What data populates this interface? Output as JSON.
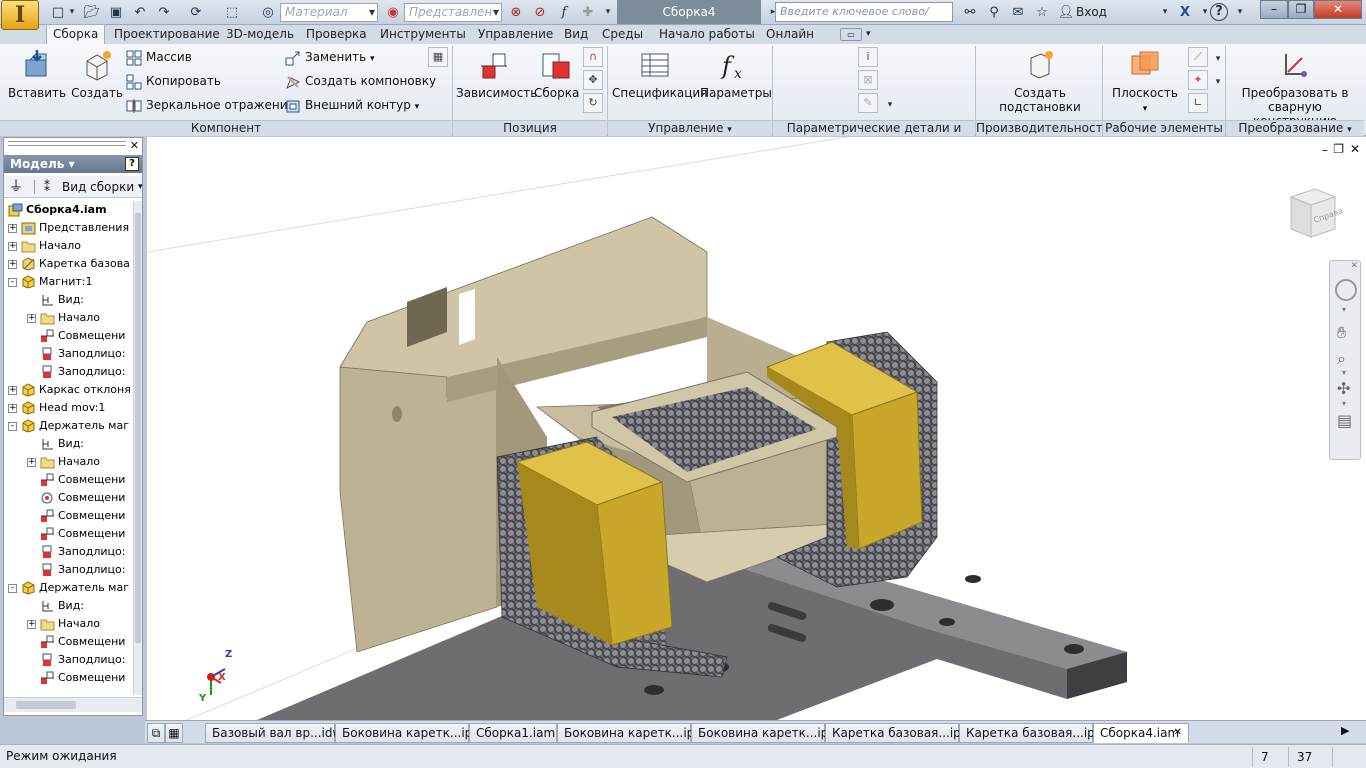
{
  "quick_access": {
    "material_combo": "Материал",
    "representation_combo": "Представлен",
    "doc_title": "Сборка4",
    "search_placeholder": "Введите ключевое слово/фразу",
    "signin_label": "Вход"
  },
  "ribbon_tabs": [
    "Сборка",
    "Проектирование",
    "3D-модель",
    "Проверка",
    "Инструменты",
    "Управление",
    "Вид",
    "Среды",
    "Начало работы",
    "Онлайн"
  ],
  "ribbon": {
    "component": {
      "title": "Компонент",
      "insert": "Вставить",
      "create": "Создать",
      "array": "Массив",
      "copy": "Копировать",
      "mirror": "Зеркальное отражение",
      "replace": "Заменить",
      "create_layout": "Создать компоновку",
      "outer_contour": "Внешний контур"
    },
    "position": {
      "title": "Позиция",
      "constraints": "Зависимость",
      "assembly": "Сборка"
    },
    "manage": {
      "title": "Управление",
      "bom": "Спецификация",
      "params": "Параметры"
    },
    "param_parts": {
      "title": "Параметрические детали и сборки"
    },
    "productivity": {
      "title": "Производительность",
      "create_sub_line1": "Создать",
      "create_sub_line2": "подстановки"
    },
    "work_features": {
      "title": "Рабочие элементы",
      "plane": "Плоскость"
    },
    "convert": {
      "title": "Преобразование",
      "to_weld_line1": "Преобразовать в",
      "to_weld_line2": "сварную конструкцию"
    }
  },
  "browser": {
    "header": "Модель",
    "view_mode": "Вид сборки",
    "tree": [
      {
        "label": "Сборка4.iam",
        "level": 0,
        "icon": "assembly-icon",
        "expander": "",
        "bold": true
      },
      {
        "label": "Представления",
        "level": 0,
        "icon": "representations-icon",
        "expander": "+"
      },
      {
        "label": "Начало",
        "level": 0,
        "icon": "folder-icon",
        "expander": "+"
      },
      {
        "label": "Каретка базова",
        "level": 0,
        "icon": "part-grounded-icon",
        "expander": "+"
      },
      {
        "label": "Магнит:1",
        "level": 0,
        "icon": "subassembly-icon",
        "expander": "-"
      },
      {
        "label": "Вид:",
        "level": 1,
        "icon": "view-icon",
        "expander": ""
      },
      {
        "label": "Начало",
        "level": 1,
        "icon": "folder-icon",
        "expander": "+"
      },
      {
        "label": "Совмещени",
        "level": 1,
        "icon": "mate-constraint-icon",
        "expander": ""
      },
      {
        "label": "Заподлицо:",
        "level": 1,
        "icon": "flush-constraint-icon",
        "expander": ""
      },
      {
        "label": "Заподлицо:",
        "level": 1,
        "icon": "flush-constraint-icon",
        "expander": ""
      },
      {
        "label": "Каркас отклоня",
        "level": 0,
        "icon": "subassembly-icon",
        "expander": "+"
      },
      {
        "label": "Head mov:1",
        "level": 0,
        "icon": "subassembly-icon",
        "expander": "+"
      },
      {
        "label": "Держатель маг",
        "level": 0,
        "icon": "subassembly-icon",
        "expander": "-"
      },
      {
        "label": "Вид:",
        "level": 1,
        "icon": "view-icon",
        "expander": ""
      },
      {
        "label": "Начало",
        "level": 1,
        "icon": "folder-icon",
        "expander": "+"
      },
      {
        "label": "Совмещени",
        "level": 1,
        "icon": "mate-constraint-icon",
        "expander": ""
      },
      {
        "label": "Совмещени",
        "level": 1,
        "icon": "insert-constraint-icon",
        "expander": ""
      },
      {
        "label": "Совмещени",
        "level": 1,
        "icon": "mate-constraint-icon",
        "expander": ""
      },
      {
        "label": "Совмещени",
        "level": 1,
        "icon": "mate-constraint-icon",
        "expander": ""
      },
      {
        "label": "Заподлицо:",
        "level": 1,
        "icon": "flush-constraint-icon",
        "expander": ""
      },
      {
        "label": "Заподлицо:",
        "level": 1,
        "icon": "flush-constraint-icon",
        "expander": ""
      },
      {
        "label": "Держатель маг",
        "level": 0,
        "icon": "subassembly-icon",
        "expander": "-"
      },
      {
        "label": "Вид:",
        "level": 1,
        "icon": "view-icon",
        "expander": ""
      },
      {
        "label": "Начало",
        "level": 1,
        "icon": "folder-icon",
        "expander": "+"
      },
      {
        "label": "Совмещени",
        "level": 1,
        "icon": "mate-constraint-icon",
        "expander": ""
      },
      {
        "label": "Заподлицо:",
        "level": 1,
        "icon": "flush-constraint-icon",
        "expander": ""
      },
      {
        "label": "Совмещени",
        "level": 1,
        "icon": "mate-constraint-icon",
        "expander": ""
      }
    ]
  },
  "viewcube_label": "Справа",
  "axes": {
    "x": "X",
    "y": "Y",
    "z": "Z"
  },
  "document_tabs": [
    "Базовый вал вр...idw",
    "Боковина каретк...ipt",
    "Сборка1.iam",
    "Боковина каретк...ipt",
    "Боковина каретк...ipt",
    "Каретка базовая...ipt",
    "Каретка базовая...ipt",
    "Сборка4.iam"
  ],
  "active_document_tab": 7,
  "status": {
    "text": "Режим ожидания",
    "count1": "7",
    "count2": "37"
  },
  "colors": {
    "accent": "#1f5fa8",
    "part_beige": "#c3b89a",
    "magnet_yellow": "#c8a92a",
    "plate_gray": "#6b6b6d"
  }
}
